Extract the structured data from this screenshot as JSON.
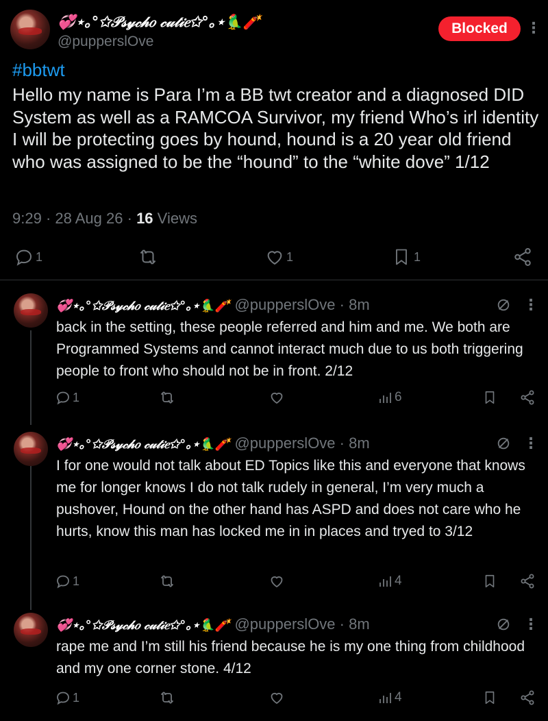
{
  "main_tweet": {
    "display_name": "💞⋆｡°✩𝒫𝓈𝓎𝒸𝒽𝑜 𝒸𝓊𝓉𝒾𝑒✩°｡⋆🦜🧨",
    "handle": "@pupperslOve",
    "blocked_label": "Blocked",
    "hashtag": "#bbtwt",
    "text": "Hello my name is Para I’m a BB twt creator and a diagnosed DID System as well as a RAMCOA Survivor, my friend Who’s irl identity I will be protecting goes by hound, hound is a 20 year old friend who was assigned to be the “hound” to the “white dove” 1/12",
    "time": "9:29",
    "date": "28 Aug 26",
    "views_count": "16",
    "views_label": "Views",
    "replies": "1",
    "likes": "1",
    "bookmarks": "1"
  },
  "replies": [
    {
      "display_name": "💞⋆｡°✩𝒫𝓈𝓎𝒸𝒽𝑜 𝒸𝓊𝓉𝒾𝑒✩°｡⋆🦜🧨",
      "handle": "@pupperslOve",
      "time": "8m",
      "text": "back in the setting, these people referred and him and me. We both are Programmed Systems and cannot interact much due to us both triggering people to front who should not be in front. 2/12",
      "replies": "1",
      "views": "6"
    },
    {
      "display_name": "💞⋆｡°✩𝒫𝓈𝓎𝒸𝒽𝑜 𝒸𝓊𝓉𝒾𝑒✩°｡⋆🦜🧨",
      "handle": "@pupperslOve",
      "time": "8m",
      "text": "I for one would not talk about ED Topics like this and everyone that knows me for longer knows I do not talk rudely in general, I’m very much a pushover, Hound on the other hand has ASPD and does not care who he hurts, know this man has locked me in in places and tryed to 3/12",
      "replies": "1",
      "views": "4"
    },
    {
      "display_name": "💞⋆｡°✩𝒫𝓈𝓎𝒸𝒽𝑜 𝒸𝓊𝓉𝒾𝑒✩°｡⋆🦜🧨",
      "handle": "@pupperslOve",
      "time": "8m",
      "text": "rape me and I’m still his friend because he is my one thing from childhood and my one corner stone. 4/12",
      "replies": "1",
      "views": "4"
    }
  ],
  "colors": {
    "accent": "#1d9bf0",
    "blocked": "#f4212e",
    "muted": "#71767b",
    "text": "#e7e9ea"
  }
}
